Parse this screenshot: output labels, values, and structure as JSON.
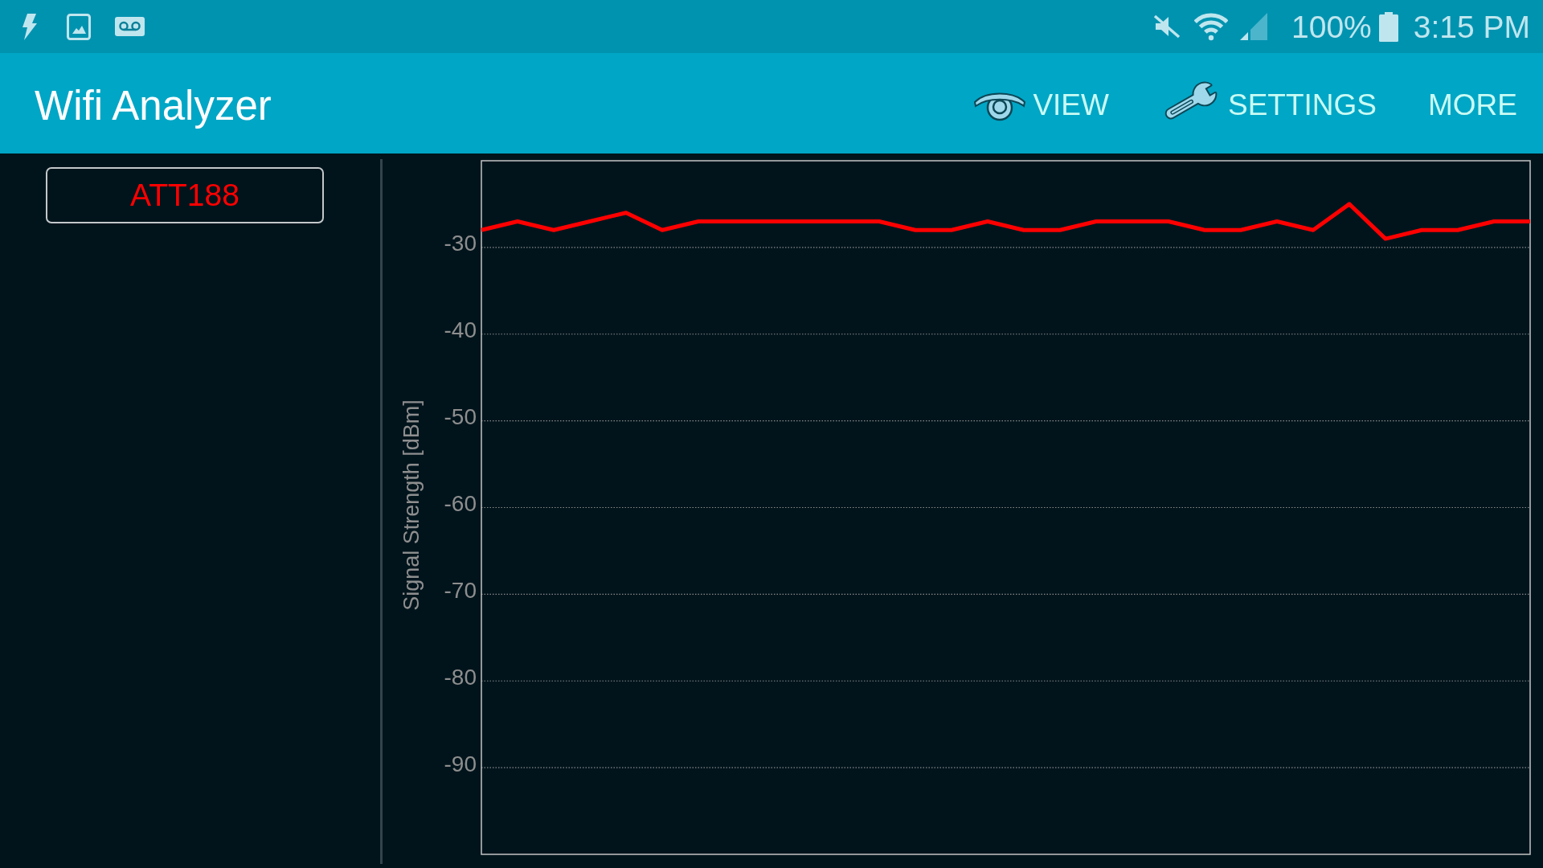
{
  "status_bar": {
    "battery": "100%",
    "time": "3:15 PM"
  },
  "action_bar": {
    "title": "Wifi Analyzer",
    "actions": [
      {
        "kind": "view",
        "label": "VIEW"
      },
      {
        "kind": "settings",
        "label": "SETTINGS"
      },
      {
        "kind": "overflow",
        "label": "MORE"
      }
    ]
  },
  "graph": {
    "chart_data": {
      "type": "line",
      "ylabel": "Signal Strength [dBm]",
      "ylim": [
        -100,
        -20
      ],
      "yticks": [
        -30,
        -40,
        -50,
        -60,
        -70,
        -80,
        -90
      ],
      "grid": true,
      "series": [
        {
          "name": "ATT188",
          "color": "#ff0000",
          "values": [
            -28,
            -27,
            -28,
            -27,
            -26,
            -28,
            -27,
            -27,
            -27,
            -27,
            -27,
            -27,
            -28,
            -28,
            -27,
            -28,
            -28,
            -27,
            -27,
            -27,
            -28,
            -28,
            -27,
            -28,
            -25,
            -29,
            -28,
            -28,
            -27,
            -27
          ]
        }
      ]
    }
  }
}
